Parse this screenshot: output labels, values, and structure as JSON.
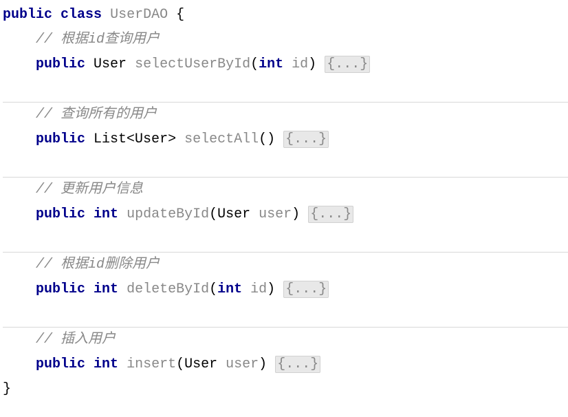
{
  "class": {
    "modifier": "public",
    "kw": "class",
    "name": "UserDAO",
    "open_brace": "{",
    "close_brace": "}"
  },
  "fold_marker": "{...}",
  "methods": [
    {
      "comment": "// 根据id查询用户",
      "modifier": "public",
      "return_type": "User",
      "name": "selectUserById",
      "param_type": "int",
      "param_type_kw": true,
      "param_name": "id"
    },
    {
      "comment": "// 查询所有的用户",
      "modifier": "public",
      "return_type": "List<User>",
      "name": "selectAll",
      "param_type": "",
      "param_type_kw": false,
      "param_name": ""
    },
    {
      "comment": "// 更新用户信息",
      "modifier": "public",
      "return_type_kw": true,
      "return_type": "int",
      "name": "updateById",
      "param_type": "User",
      "param_type_kw": false,
      "param_name": "user"
    },
    {
      "comment": "// 根据id删除用户",
      "modifier": "public",
      "return_type_kw": true,
      "return_type": "int",
      "name": "deleteById",
      "param_type": "int",
      "param_type_kw": true,
      "param_name": "id"
    },
    {
      "comment": "// 插入用户",
      "modifier": "public",
      "return_type_kw": true,
      "return_type": "int",
      "name": "insert",
      "param_type": "User",
      "param_type_kw": false,
      "param_name": "user"
    }
  ]
}
